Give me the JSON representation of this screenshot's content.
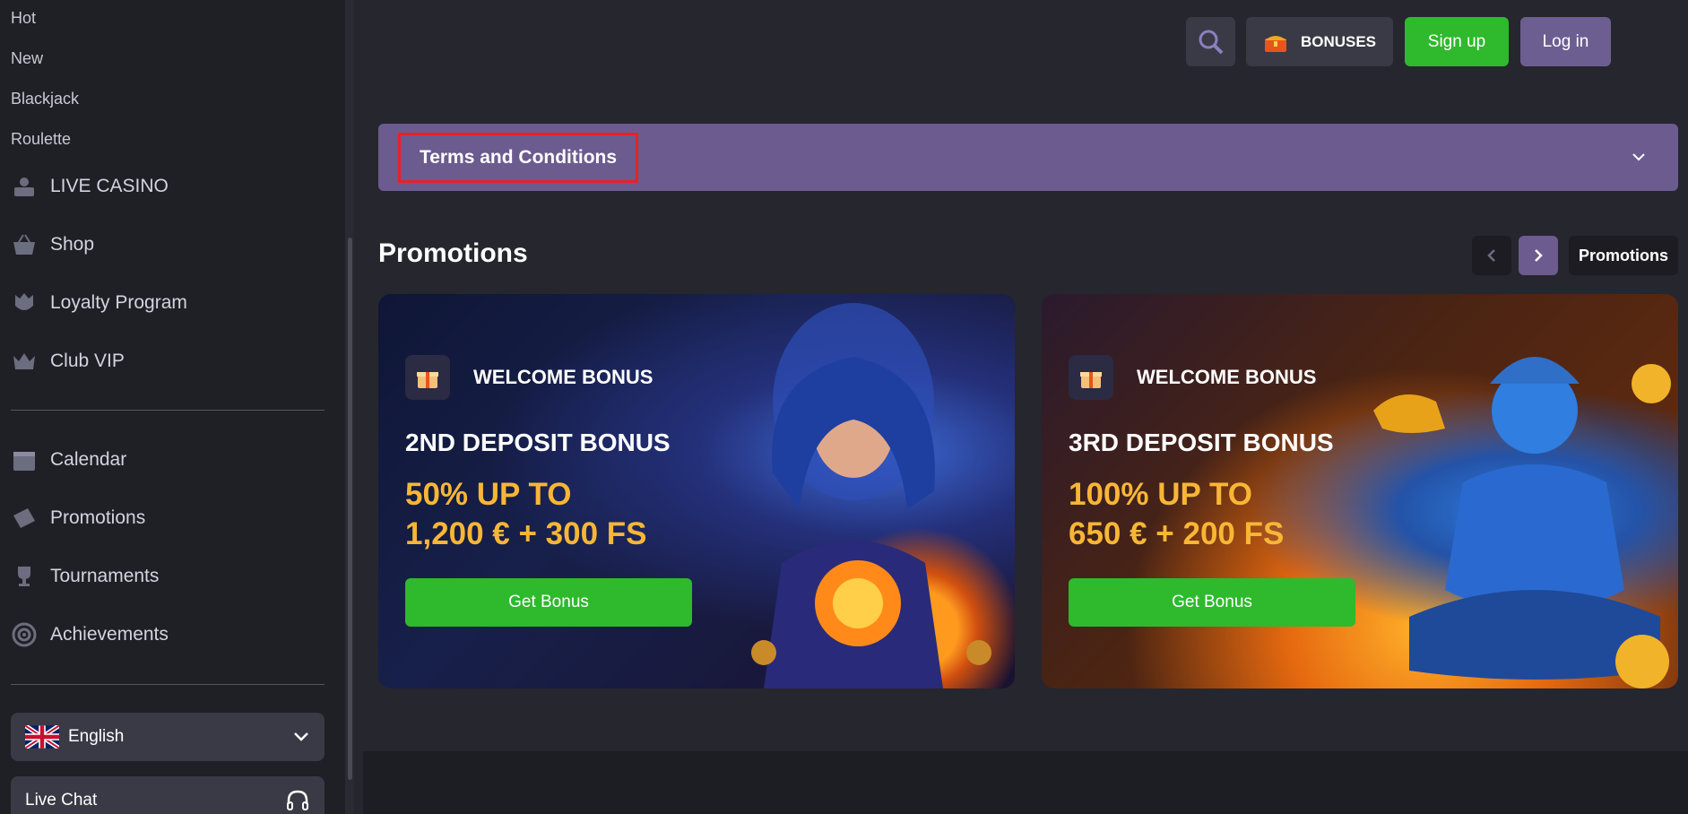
{
  "sidebar": {
    "sub_items": [
      "Hot",
      "New",
      "Blackjack",
      "Roulette"
    ],
    "nav_group1": [
      {
        "label": "LIVE CASINO",
        "icon": "live-casino-icon"
      },
      {
        "label": "Shop",
        "icon": "basket-icon"
      },
      {
        "label": "Loyalty Program",
        "icon": "crown-shield-icon"
      },
      {
        "label": "Club VIP",
        "icon": "crown-icon"
      }
    ],
    "nav_group2": [
      {
        "label": "Calendar",
        "icon": "calendar-icon"
      },
      {
        "label": "Promotions",
        "icon": "ticket-icon"
      },
      {
        "label": "Tournaments",
        "icon": "trophy-icon"
      },
      {
        "label": "Achievements",
        "icon": "target-icon"
      }
    ],
    "language": "English",
    "live_chat": "Live Chat"
  },
  "header": {
    "bonuses": "BONUSES",
    "signup": "Sign up",
    "login": "Log in"
  },
  "terms": {
    "title": "Terms and Conditions"
  },
  "promotions": {
    "heading": "Promotions",
    "link": "Promotions",
    "cards": [
      {
        "badge": "WELCOME BONUS",
        "deposit": "2ND DEPOSIT BONUS",
        "offer_line1": "50% UP TO",
        "offer_line2": "1,200 € + 300 FS",
        "button": "Get Bonus"
      },
      {
        "badge": "WELCOME BONUS",
        "deposit": "3RD DEPOSIT BONUS",
        "offer_line1": "100% UP TO",
        "offer_line2": "650 € + 200 FS",
        "button": "Get Bonus"
      }
    ]
  },
  "colors": {
    "accent_purple": "#6b5b8f",
    "green": "#2fb92d",
    "gold": "#f8b636",
    "highlight_red": "#e8202a"
  }
}
